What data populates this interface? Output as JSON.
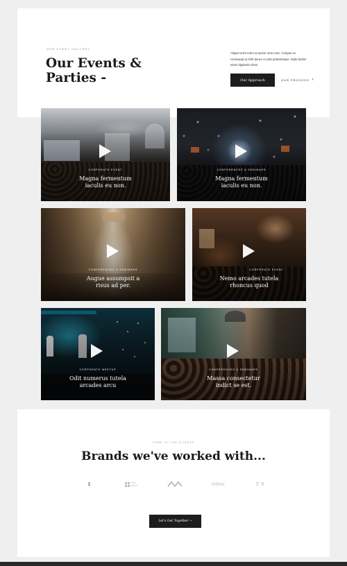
{
  "hero": {
    "kicker": "OUR EVENT GALLERY",
    "title": "Our Events & Parties -",
    "description": "Aliquet enim tortor at auctor urna nunc. Congue eu consequat ac felis donec et odio pellentesque. Nulla facilisi etiam dignissim diam.",
    "primary_button": "Our Approach",
    "secondary_link": "OUR PROCESS",
    "secondary_arrow": "›"
  },
  "events": [
    {
      "category": "CORPORATE EVENT",
      "title": "Magna fermentum iaculis eu non.",
      "icon": "play-icon"
    },
    {
      "category": "CONFERENCES & SEMINARS",
      "title": "Magna fermentum iaculis eu non.",
      "icon": "play-icon"
    },
    {
      "category": "CONFERENCES & SEMINARS",
      "title": "Augue assumpsit a risus ad per.",
      "icon": "play-icon"
    },
    {
      "category": "CORPORATE EVENT",
      "title": "Nemo arcades tutela rhoncus quod",
      "icon": "play-icon"
    },
    {
      "category": "CORPORATE MEETUP",
      "title": "Odit numerus tutela arcades arcu",
      "icon": "play-icon"
    },
    {
      "category": "CONFERENCES & SEMINARS",
      "title": "Massa consectetur indict se est.",
      "icon": "play-icon"
    }
  ],
  "clients": {
    "kicker": "SOME OF THE CLIENTS",
    "title": "Brands we've worked with...",
    "logos": [
      {
        "icon": "crescent-logo-icon",
        "text": ""
      },
      {
        "icon": "grid-logo-icon",
        "text": "rare pyser"
      },
      {
        "icon": "wave-logo-icon",
        "text": ""
      },
      {
        "icon": "mitsui-logo-icon",
        "text": "mitsui"
      },
      {
        "icon": "rs-logo-icon",
        "text": "r s"
      }
    ],
    "cta_button": "Let's Get Together →"
  },
  "colors": {
    "background": "#efefef",
    "panel": "#ffffff",
    "accent_dark": "#1d1d1d",
    "logo_gray": "#bdbdbd"
  }
}
